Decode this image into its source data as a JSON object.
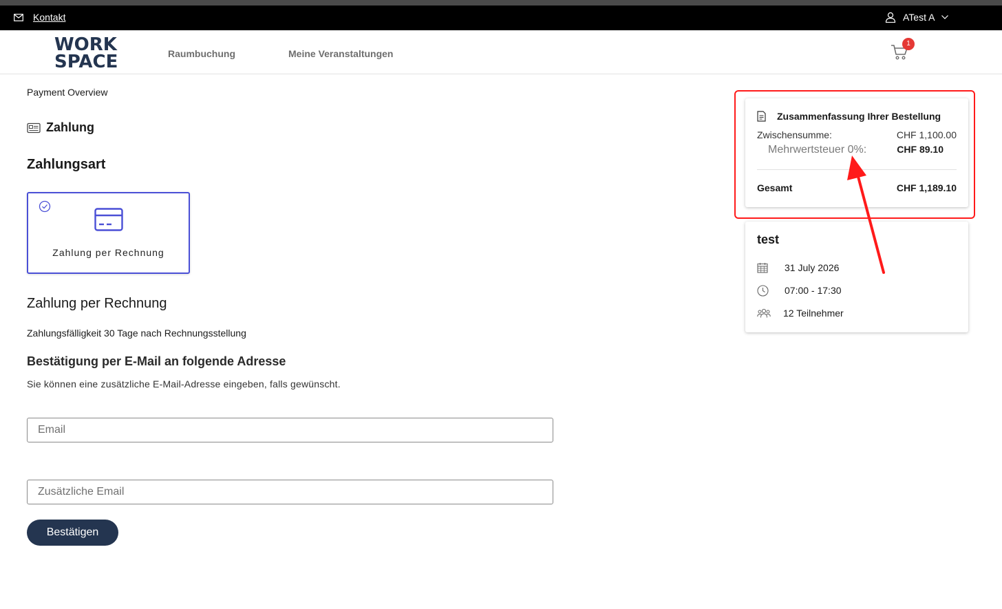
{
  "topbar": {
    "contact_label": "Kontakt",
    "user_name": "ATest A"
  },
  "nav": {
    "logo_line1": "WORK",
    "logo_line2": "SPACE",
    "links": [
      "Raumbuchung",
      "Meine Veranstaltungen"
    ],
    "cart_count": "1"
  },
  "page": {
    "breadcrumb": "Payment Overview",
    "section_title": "Zahlung",
    "payment_type_heading": "Zahlungsart",
    "payment_method_label": "Zahlung per Rechnung",
    "invoice_heading": "Zahlung per Rechnung",
    "due_text": "Zahlungsfälligkeit 30 Tage nach Rechnungsstellung",
    "confirm_heading": "Bestätigung per E-Mail an folgende Adresse",
    "confirm_hint": "Sie können eine zusätzliche E-Mail-Adresse eingeben, falls gewünscht.",
    "email_placeholder": "Email",
    "email_value": "",
    "additional_email_placeholder": "Zusätzliche Email",
    "additional_email_value": "",
    "confirm_button": "Bestätigen"
  },
  "summary": {
    "title": "Zusammenfassung Ihrer Bestellung",
    "subtotal_label": "Zwischensumme:",
    "subtotal_value": "CHF 1,100.00",
    "vat_label": "Mehrwertsteuer 0%:",
    "vat_value": "CHF 89.10",
    "total_label": "Gesamt",
    "total_value": "CHF 1,189.10"
  },
  "booking": {
    "name": "test",
    "date": "31 July 2026",
    "time": "07:00 - 17:30",
    "participants": "12 Teilnehmer"
  },
  "colors": {
    "brand_navy": "#243550",
    "accent_purple": "#4a4fd6",
    "annotation_red": "#ff1a1a",
    "badge_red": "#e53935"
  }
}
